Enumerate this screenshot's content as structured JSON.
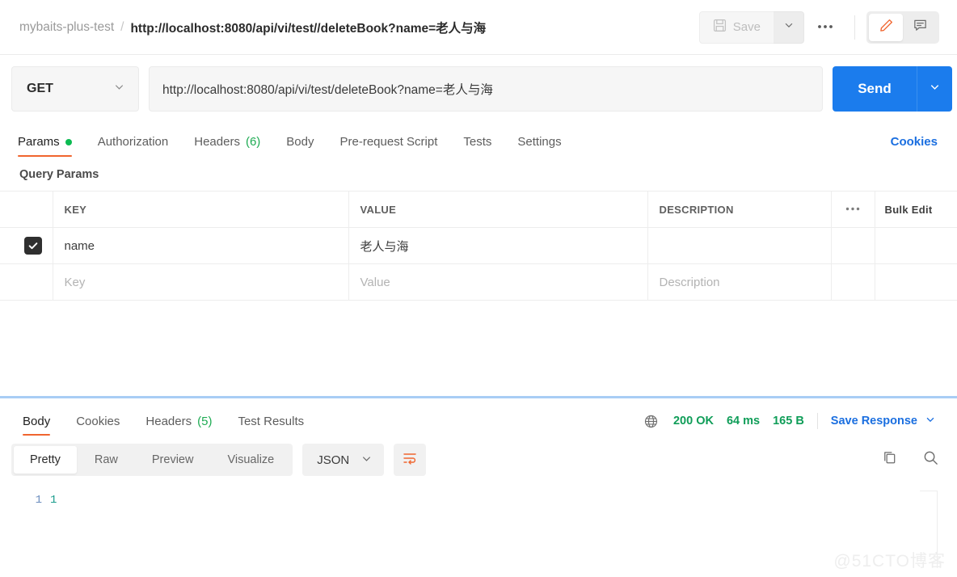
{
  "header": {
    "collection": "mybaits-plus-test",
    "separator": "/",
    "request_title": "http://localhost:8080/api/vi/test//deleteBook?name=老人与海",
    "save_label": "Save",
    "save_icon": "floppy-disk-icon",
    "save_caret_icon": "chevron-down-icon",
    "more_label": "⋯",
    "edit_icon": "pencil-icon",
    "comment_icon": "comment-icon"
  },
  "url_row": {
    "method": "GET",
    "method_caret": "chevron-down-icon",
    "url": "http://localhost:8080/api/vi/test/deleteBook?name=老人与海",
    "send_label": "Send",
    "send_caret_icon": "chevron-down-icon"
  },
  "request_tabs": {
    "items": [
      {
        "label": "Params",
        "active": true,
        "dot": true
      },
      {
        "label": "Authorization",
        "active": false
      },
      {
        "label": "Headers",
        "count": "(6)",
        "active": false
      },
      {
        "label": "Body",
        "active": false
      },
      {
        "label": "Pre-request Script",
        "active": false
      },
      {
        "label": "Tests",
        "active": false
      },
      {
        "label": "Settings",
        "active": false
      }
    ],
    "cookies_link": "Cookies"
  },
  "query_params": {
    "section_label": "Query Params",
    "columns": [
      "KEY",
      "VALUE",
      "DESCRIPTION"
    ],
    "options_icon": "ellipsis-icon",
    "bulk_edit_label": "Bulk Edit",
    "rows": [
      {
        "checked": true,
        "key": "name",
        "value": "老人与海",
        "description": ""
      }
    ],
    "placeholder_row": {
      "key": "Key",
      "value": "Value",
      "description": "Description"
    }
  },
  "response": {
    "tabs": [
      {
        "label": "Body",
        "active": true
      },
      {
        "label": "Cookies",
        "active": false
      },
      {
        "label": "Headers",
        "count": "(5)",
        "active": false
      },
      {
        "label": "Test Results",
        "active": false
      }
    ],
    "network_icon": "globe-icon",
    "status": "200 OK",
    "time": "64 ms",
    "size": "165 B",
    "save_response_label": "Save Response",
    "save_response_caret": "chevron-down-icon",
    "view_modes": [
      {
        "label": "Pretty",
        "active": true
      },
      {
        "label": "Raw",
        "active": false
      },
      {
        "label": "Preview",
        "active": false
      },
      {
        "label": "Visualize",
        "active": false
      }
    ],
    "format": "JSON",
    "format_caret": "chevron-down-icon",
    "wrap_icon": "word-wrap-icon",
    "copy_icon": "copy-icon",
    "search_icon": "search-icon",
    "body_lines": [
      {
        "number": "1",
        "text": "1"
      }
    ]
  },
  "watermark": "@51CTO博客",
  "colors": {
    "accent_orange": "#f0652f",
    "link_blue": "#1b6fe0",
    "send_blue": "#1b7ced",
    "status_green": "#0f9d58",
    "dot_green": "#0cbb52"
  }
}
